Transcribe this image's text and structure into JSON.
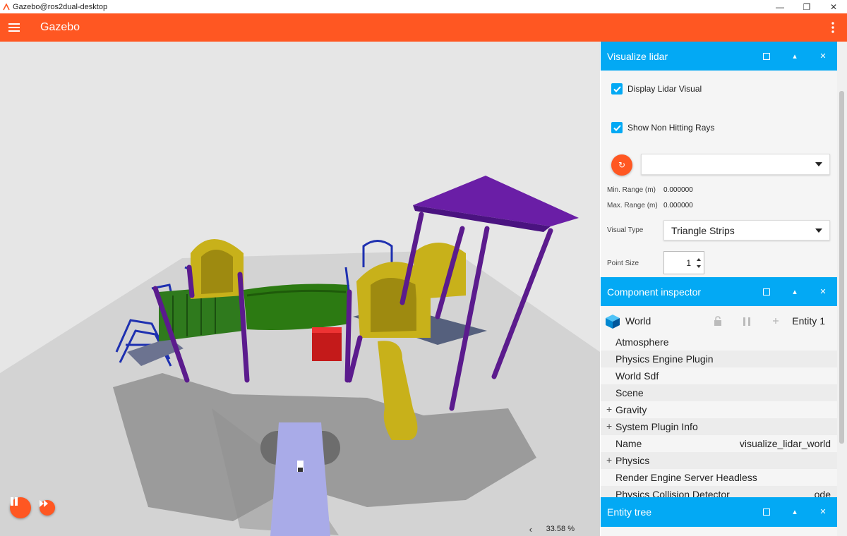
{
  "window": {
    "title": "Gazebo@ros2dual-desktop",
    "minimize": "—",
    "restore": "❐",
    "close": "✕"
  },
  "appbar": {
    "title": "Gazebo"
  },
  "scene": {
    "rtf": "33.58 %",
    "rtf_arrow": "‹"
  },
  "colors": {
    "accent": "#ff5722",
    "panel_header": "#03a9f4"
  },
  "lidar_panel": {
    "title": "Visualize lidar",
    "display_lidar_visual": {
      "label": "Display Lidar Visual",
      "checked": true
    },
    "show_non_hitting_rays": {
      "label": "Show Non Hitting Rays",
      "checked": true
    },
    "topic_value": "",
    "min_range_label": "Min. Range (m)",
    "min_range_value": "0.000000",
    "max_range_label": "Max. Range (m)",
    "max_range_value": "0.000000",
    "visual_type_label": "Visual Type",
    "visual_type_value": "Triangle Strips",
    "point_size_label": "Point Size",
    "point_size_value": "1"
  },
  "inspector": {
    "title": "Component inspector",
    "entity_name": "World",
    "entity_id": "Entity 1",
    "rows": [
      {
        "label": "Atmosphere",
        "value": "",
        "expandable": false
      },
      {
        "label": "Physics Engine Plugin",
        "value": "",
        "expandable": false
      },
      {
        "label": "World Sdf",
        "value": "",
        "expandable": false
      },
      {
        "label": "Scene",
        "value": "",
        "expandable": false
      },
      {
        "label": "Gravity",
        "value": "",
        "expandable": true
      },
      {
        "label": "System Plugin Info",
        "value": "",
        "expandable": true
      },
      {
        "label": "Name",
        "value": "visualize_lidar_world",
        "expandable": false
      },
      {
        "label": "Physics",
        "value": "",
        "expandable": true
      },
      {
        "label": "Render Engine Server Headless",
        "value": "",
        "expandable": false
      },
      {
        "label": "Physics Collision Detector",
        "value": "ode",
        "expandable": false
      }
    ]
  },
  "entity_tree": {
    "title": "Entity tree"
  },
  "panel_buttons": {
    "collapse": "▴",
    "close": "✕"
  }
}
